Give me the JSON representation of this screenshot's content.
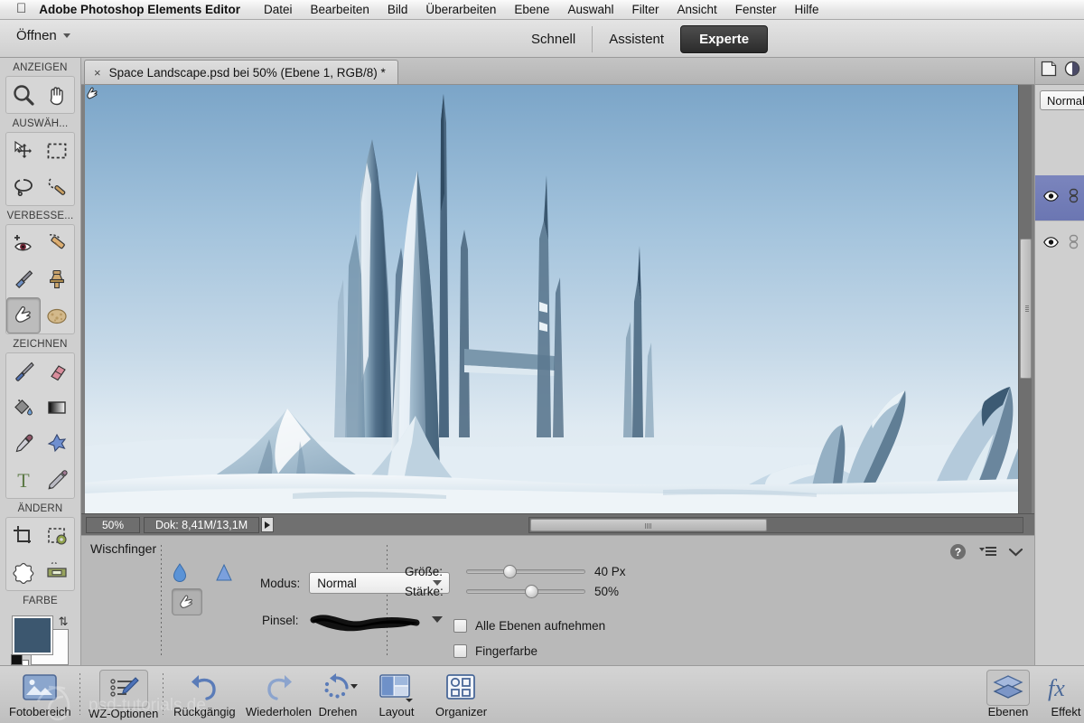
{
  "menubar": {
    "apple_icon": "apple-logo-icon",
    "app_name": "Adobe Photoshop Elements Editor",
    "items": [
      "Datei",
      "Bearbeiten",
      "Bild",
      "Überarbeiten",
      "Ebene",
      "Auswahl",
      "Filter",
      "Ansicht",
      "Fenster",
      "Hilfe"
    ]
  },
  "modebar": {
    "open_label": "Öffnen",
    "modes": [
      {
        "label": "Schnell",
        "active": false
      },
      {
        "label": "Assistent",
        "active": false
      },
      {
        "label": "Experte",
        "active": true
      }
    ]
  },
  "toolbar": {
    "sections": [
      {
        "label": "ANZEIGEN",
        "tools": [
          "zoom-tool",
          "hand-tool"
        ]
      },
      {
        "label": "AUSWÄH...",
        "tools": [
          "move-tool",
          "rectangular-marquee-tool",
          "lasso-tool",
          "magic-wand-tool"
        ]
      },
      {
        "label": "VERBESSE...",
        "tools": [
          "red-eye-removal-tool",
          "spot-healing-brush-tool",
          "smart-brush-tool",
          "clone-stamp-tool",
          "smudge-tool",
          "sponge-tool"
        ]
      },
      {
        "label": "ZEICHNEN",
        "tools": [
          "brush-tool",
          "eraser-tool",
          "paint-bucket-tool",
          "gradient-tool",
          "eyedropper-tool",
          "custom-shape-tool",
          "type-tool",
          "pencil-tool"
        ]
      },
      {
        "label": "ÄNDERN",
        "tools": [
          "crop-tool",
          "recompose-tool",
          "cookie-cutter-tool",
          "straighten-tool"
        ]
      }
    ],
    "color_section_label": "FARBE",
    "foreground_color": "#3c576f",
    "background_color": "#fdfdfd",
    "selected_tool": "smudge-tool"
  },
  "document": {
    "tab_title": "Space Landscape.psd bei 50% (Ebene 1, RGB/8) *",
    "close_icon": "close-icon"
  },
  "statusbar": {
    "zoom": "50%",
    "doc_info": "Dok: 8,41M/13,1M"
  },
  "tool_options": {
    "title": "Wischfinger",
    "preset_icons": [
      "water-drop-icon",
      "blur-triangle-icon",
      "smudge-finger-icon"
    ],
    "mode_label": "Modus:",
    "mode_value": "Normal",
    "brush_label": "Pinsel:",
    "size_label": "Größe:",
    "size_value": "40 Px",
    "size_percent": 30,
    "strength_label": "Stärke:",
    "strength_value": "50%",
    "strength_percent": 50,
    "checkboxes": [
      {
        "label": "Alle Ebenen aufnehmen",
        "checked": false
      },
      {
        "label": "Fingerfarbe",
        "checked": false
      }
    ],
    "panel_controls": [
      "help-icon",
      "panel-menu-icon",
      "chevron-down-icon"
    ]
  },
  "right_panel": {
    "header_icons": [
      "new-layer-icon",
      "adjustment-layer-icon"
    ],
    "blend_mode": "Normal",
    "layers": [
      {
        "visibility_icon": "eye-icon",
        "link_icon": "link-icon",
        "selected": true
      },
      {
        "visibility_icon": "eye-icon",
        "link_icon": "link-icon",
        "selected": false
      }
    ]
  },
  "taskbar": {
    "items": [
      {
        "label": "Fotobereich",
        "icon": "photo-bin-icon",
        "active": false
      },
      {
        "label": "WZ-Optionen",
        "icon": "tool-options-icon",
        "active": true
      },
      {
        "label": "Rückgängig",
        "icon": "undo-icon",
        "active": false
      },
      {
        "label": "Wiederholen",
        "icon": "redo-icon",
        "active": false
      },
      {
        "label": "Drehen",
        "icon": "rotate-icon",
        "active": false
      },
      {
        "label": "Layout",
        "icon": "layout-icon",
        "active": false
      },
      {
        "label": "Organizer",
        "icon": "organizer-icon",
        "active": false
      }
    ],
    "right_items": [
      {
        "label": "Ebenen",
        "icon": "layers-icon",
        "active": true
      },
      {
        "label": "Effekt",
        "icon": "effects-fx-icon",
        "active": false
      }
    ]
  },
  "artwork": {
    "title": "Space Landscape",
    "description": "Icy alien landscape with tall frozen spires and snow mountains",
    "sky_top_color": "#7ba5c8",
    "sky_bottom_color": "#e7eef4",
    "ice_color": "#4b6f8c",
    "snow_color": "#eef4f8"
  }
}
